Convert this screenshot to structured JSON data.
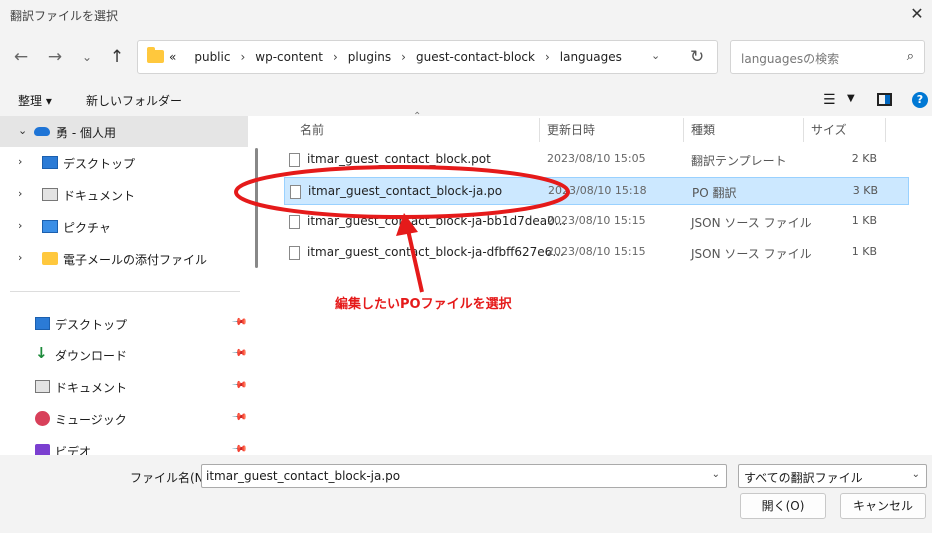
{
  "window": {
    "title": "翻訳ファイルを選択"
  },
  "nav": {
    "breadcrumb": [
      "public",
      "wp-content",
      "plugins",
      "guest-contact-block",
      "languages"
    ],
    "overflow": "«",
    "search_placeholder": "languagesの検索"
  },
  "toolbar": {
    "organize": "整理 ▾",
    "new_folder": "新しいフォルダー"
  },
  "sidebar": {
    "tree": [
      {
        "label": "勇 - 個人用",
        "icon": "cloud-icon"
      },
      {
        "label": "デスクトップ",
        "icon": "desktop-icon"
      },
      {
        "label": "ドキュメント",
        "icon": "document-icon"
      },
      {
        "label": "ピクチャ",
        "icon": "picture-icon"
      },
      {
        "label": "電子メールの添付ファイル",
        "icon": "folder-icon"
      }
    ],
    "quick": [
      {
        "label": "デスクトップ",
        "icon": "desktop-icon"
      },
      {
        "label": "ダウンロード",
        "icon": "download-icon"
      },
      {
        "label": "ドキュメント",
        "icon": "document-icon"
      },
      {
        "label": "ミュージック",
        "icon": "music-icon"
      },
      {
        "label": "ビデオ",
        "icon": "video-icon"
      }
    ]
  },
  "columns": {
    "name": "名前",
    "date": "更新日時",
    "type": "種類",
    "size": "サイズ"
  },
  "files": [
    {
      "name": "itmar_guest_contact_block.pot",
      "date": "2023/08/10 15:05",
      "type": "翻訳テンプレート",
      "size": "2 KB"
    },
    {
      "name": "itmar_guest_contact_block-ja.po",
      "date": "2023/08/10 15:18",
      "type": "PO 翻訳",
      "size": "3 KB"
    },
    {
      "name": "itmar_guest_contact_block-ja-bb1d7dea0...",
      "date": "2023/08/10 15:15",
      "type": "JSON ソース ファイル",
      "size": "1 KB"
    },
    {
      "name": "itmar_guest_contact_block-ja-dfbff627e6...",
      "date": "2023/08/10 15:15",
      "type": "JSON ソース ファイル",
      "size": "1 KB"
    }
  ],
  "annotation": {
    "text": "編集したいPOファイルを選択",
    "color": "#e51a1a"
  },
  "footer": {
    "filename_label": "ファイル名(N):",
    "filename_value": "itmar_guest_contact_block-ja.po",
    "filter": "すべての翻訳ファイル",
    "open": "開く(O)",
    "cancel": "キャンセル"
  }
}
